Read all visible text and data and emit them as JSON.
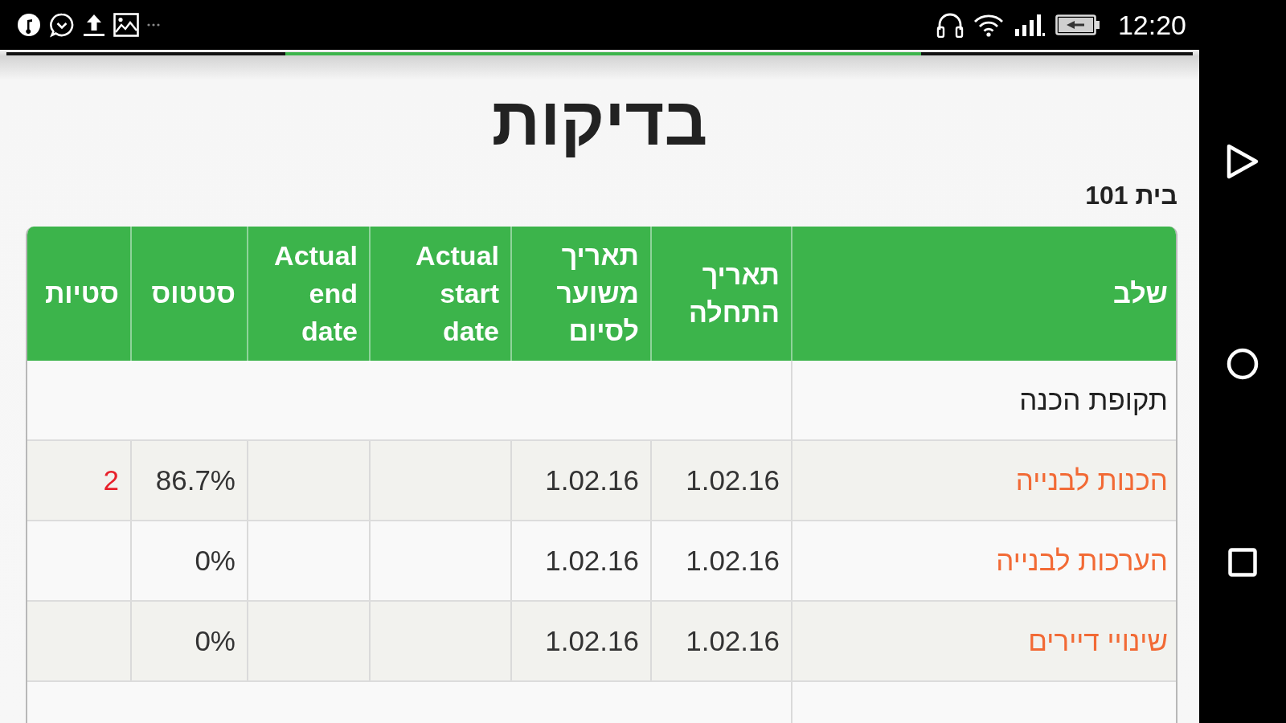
{
  "status_bar": {
    "time": "12:20"
  },
  "page": {
    "title": "בדיקות",
    "building": "בית 101"
  },
  "table": {
    "columns": [
      "שלב",
      "תאריך התחלה",
      "תאריך משוער לסיום",
      "Actual start date",
      "Actual end date",
      "סטטוס",
      "סטיות"
    ],
    "rows": [
      {
        "kind": "section",
        "stage": "תקופת הכנה"
      },
      {
        "kind": "stage",
        "stage": "הכנות לבנייה",
        "start_date": "1.02.16",
        "estimated_end": "1.02.16",
        "status": "86.7%",
        "deviations": "2"
      },
      {
        "kind": "stage",
        "stage": "הערכות לבנייה",
        "start_date": "1.02.16",
        "estimated_end": "1.02.16",
        "status": "0%"
      },
      {
        "kind": "stage",
        "stage": "שינויי דיירים",
        "start_date": "1.02.16",
        "estimated_end": "1.02.16",
        "status": "0%"
      }
    ]
  }
}
